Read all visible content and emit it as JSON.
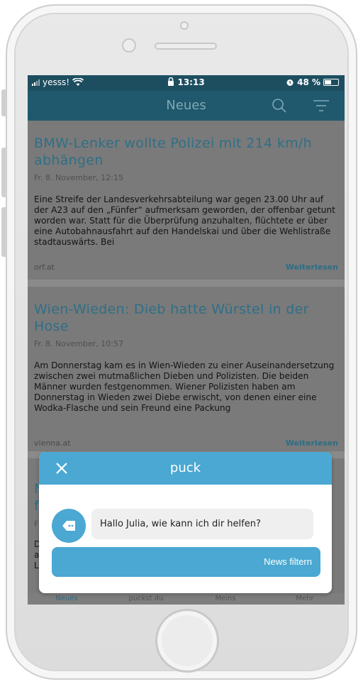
{
  "status_bar": {
    "carrier": "yesss!",
    "time": "13:13",
    "battery_percent": "48 %",
    "battery_level": 0.48
  },
  "header": {
    "title": "Neues"
  },
  "articles": [
    {
      "title": "BMW-Lenker wollte Polizei mit 214 km/h abhängen",
      "date": "Fr. 8. November, 12:15",
      "body": "Eine Streife der Landesverkehrsabteilung war gegen 23.00 Uhr auf der A23 auf den „Fünfer“ aufmerksam geworden, der offenbar getunt worden war. Statt für die Überprüfung anzuhalten, flüchtete er über eine Autobahnausfahrt auf den Handelskai und über die Wehlistraße stadtauswärts. Bei",
      "source": "orf.at",
      "more": "Weiterlesen"
    },
    {
      "title": "Wien-Wieden: Dieb hatte Würstel in der Hose",
      "date": "Fr. 8. November, 10:57",
      "body": "Am Donnerstag kam es in Wien-Wieden zu einer Auseinandersetzung zwischen zwei mutmaßlichen Dieben und Polizisten. Die beiden Männer wurden festgenommen. Wiener Polizisten haben am Donnerstag in Wieden zwei Diebe erwischt, von denen einer eine Wodka-Flasche und sein Freund eine Packung",
      "source": "vienna.at",
      "more": "Weiterlesen"
    }
  ],
  "partial_card": {
    "title_line1": "N",
    "title_line2": "f",
    "date": "F",
    "body_line1": "D",
    "body_line2": "a",
    "body_line3": "L"
  },
  "tabs": [
    {
      "label": "Neues"
    },
    {
      "label": "puckst du"
    },
    {
      "label": "Meins"
    },
    {
      "label": "Mehr"
    }
  ],
  "dialog": {
    "title": "puck",
    "message": "Hallo Julia, wie kann ich dir helfen?",
    "action_label": "News filtern"
  },
  "colors": {
    "accent": "#4aa8d2",
    "header": "#20596d",
    "status_bar": "#1d4e60"
  }
}
